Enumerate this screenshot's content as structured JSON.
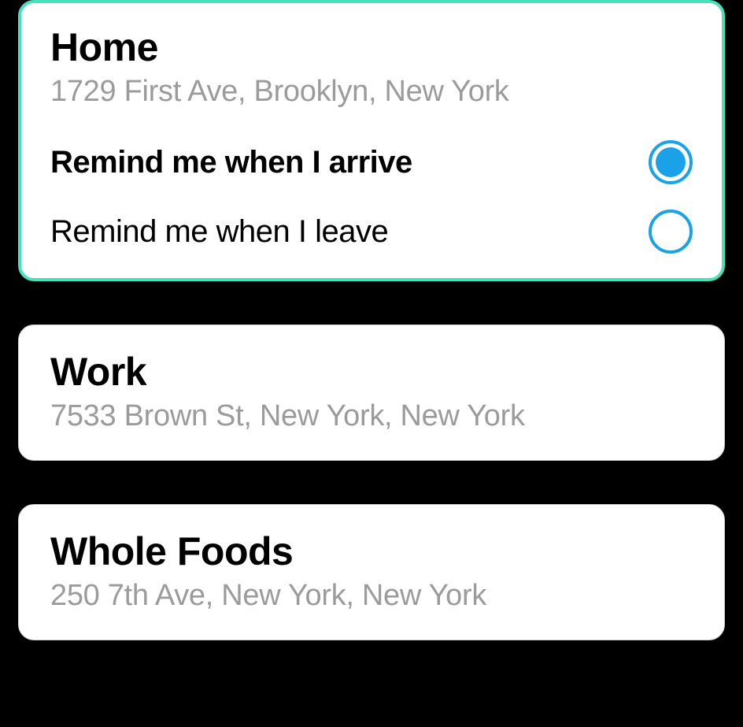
{
  "locations": [
    {
      "title": "Home",
      "address": "1729 First Ave, Brooklyn, New York",
      "selected": true,
      "options": [
        {
          "label": "Remind me when I arrive",
          "checked": true
        },
        {
          "label": "Remind me when I leave",
          "checked": false
        }
      ]
    },
    {
      "title": "Work",
      "address": "7533 Brown St, New York, New York",
      "selected": false
    },
    {
      "title": "Whole Foods",
      "address": "250 7th Ave, New York, New York",
      "selected": false
    }
  ]
}
